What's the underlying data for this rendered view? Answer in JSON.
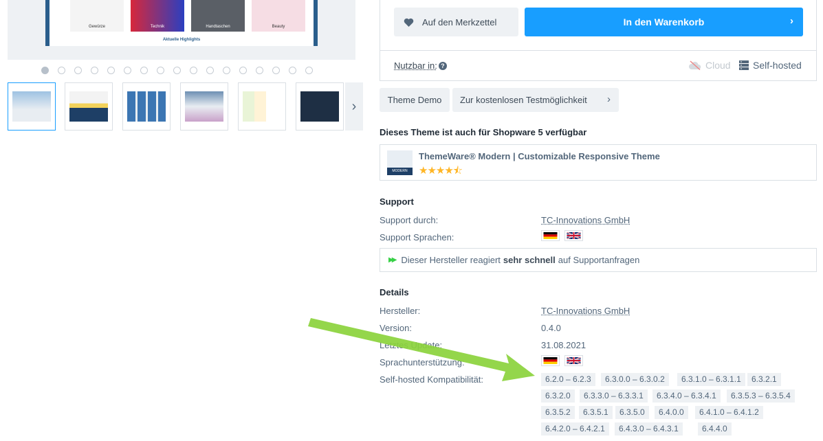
{
  "gallery": {
    "main_products": [
      "Gewürze",
      "Technik",
      "Handtaschen",
      "Beauty"
    ],
    "main_caption": "Aktuelle Highlights",
    "dot_count": 17,
    "active_dot": 0,
    "thumb_count": 6
  },
  "buybox": {
    "wishlist_label": "Auf den Merkzettel",
    "cart_label": "In den Warenkorb",
    "usable_label": "Nutzbar in:",
    "help_glyph": "?",
    "cloud_label": "Cloud",
    "selfhosted_label": "Self-hosted"
  },
  "actions": {
    "demo_label": "Theme Demo",
    "trial_label": "Zur kostenlosen Testmöglichkeit"
  },
  "sw5": {
    "heading": "Dieses Theme ist auch für Shopware 5 verfügbar",
    "name": "ThemeWare® Modern | Customizable Responsive Theme",
    "image_caption": "MODERN",
    "stars": "★★★★⯪",
    "rating": 4.5,
    "rating_max": 5
  },
  "support": {
    "heading": "Support",
    "by_label": "Support durch:",
    "by_value": "TC-Innovations GmbH",
    "languages_label": "Support Sprachen:",
    "speed_prefix": "Dieser Hersteller reagiert",
    "speed_bold": "sehr schnell",
    "speed_suffix": "auf Supportanfragen"
  },
  "details": {
    "heading": "Details",
    "manufacturer_label": "Hersteller:",
    "manufacturer_value": "TC-Innovations GmbH",
    "version_label": "Version:",
    "version_value": "0.4.0",
    "updated_label": "Letztes Update:",
    "updated_value": "31.08.2021",
    "languages_label": "Sprachunterstützung:",
    "compat_label": "Self-hosted Kompatibilität:",
    "versions": [
      "6.2.0 – 6.2.3",
      "6.3.0.0 – 6.3.0.2",
      "6.3.1.0 – 6.3.1.1",
      "6.3.2.1",
      "6.3.2.0",
      "6.3.3.0 – 6.3.3.1",
      "6.3.4.0 – 6.3.4.1",
      "6.3.5.3 – 6.3.5.4",
      "6.3.5.2",
      "6.3.5.1",
      "6.3.5.0",
      "6.4.0.0",
      "6.4.1.0 – 6.4.1.2",
      "6.4.2.0 – 6.4.2.1",
      "6.4.3.0 – 6.4.3.1",
      "6.4.4.0"
    ]
  },
  "colors": {
    "primary": "#189eff",
    "arrow": "#8bd23c",
    "star": "#ffb626",
    "speed": "#37d046"
  }
}
